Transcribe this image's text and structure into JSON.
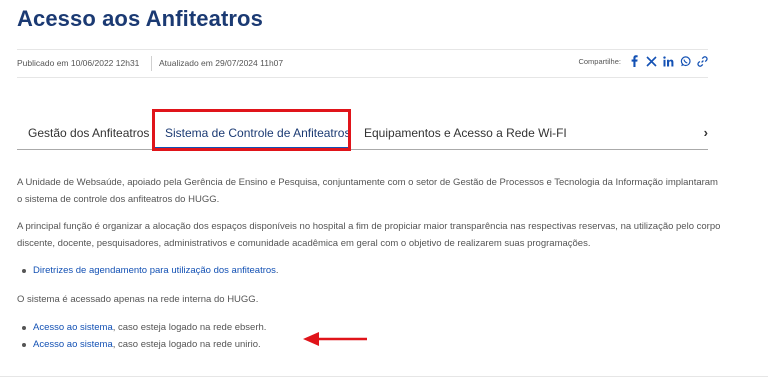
{
  "page": {
    "title": "Acesso aos Anfiteatros"
  },
  "meta": {
    "published": "Publicado em 10/06/2022 12h31",
    "updated": "Atualizado em 29/07/2024 11h07",
    "share_label": "Compartilhe:",
    "share_icons": [
      "facebook-icon",
      "x-icon",
      "linkedin-icon",
      "whatsapp-icon",
      "link-icon"
    ]
  },
  "tabs": {
    "items": [
      {
        "label": "Gestão dos Anfiteatros"
      },
      {
        "label": "Sistema de Controle de Anfiteatros"
      },
      {
        "label": "Equipamentos e Acesso a Rede Wi-FI"
      }
    ],
    "active_index": 1,
    "next_icon": "chevron-right-icon"
  },
  "content": {
    "p1": "A Unidade de Websaúde, apoiado pela Gerência de Ensino e Pesquisa, conjuntamente com o setor de Gestão de Processos e Tecnologia da Informação implantaram o sistema de controle dos anfiteatros do HUGG.",
    "p2": "A principal função é organizar a alocação dos espaços disponíveis no hospital a fim de propiciar maior transparência nas respectivas reservas, na utilização pelo corpo discente, docente, pesquisadores, administrativos e comunidade acadêmica em geral com o objetivo de realizarem suas programações.",
    "link_diretrizes": "Diretrizes de agendamento para utilização dos anfiteatros",
    "link_diretrizes_suffix": ".",
    "p3": "O sistema é acessado apenas na rede interna do HUGG.",
    "access_links": [
      {
        "link": "Acesso ao sistema",
        "suffix": ", caso esteja logado na rede ebserh."
      },
      {
        "link": "Acesso ao sistema",
        "suffix": ", caso esteja logado na rede unirio."
      }
    ]
  },
  "colors": {
    "title": "#1b3a73",
    "link": "#1351b4",
    "highlight": "#e0141a",
    "text": "#555555"
  }
}
